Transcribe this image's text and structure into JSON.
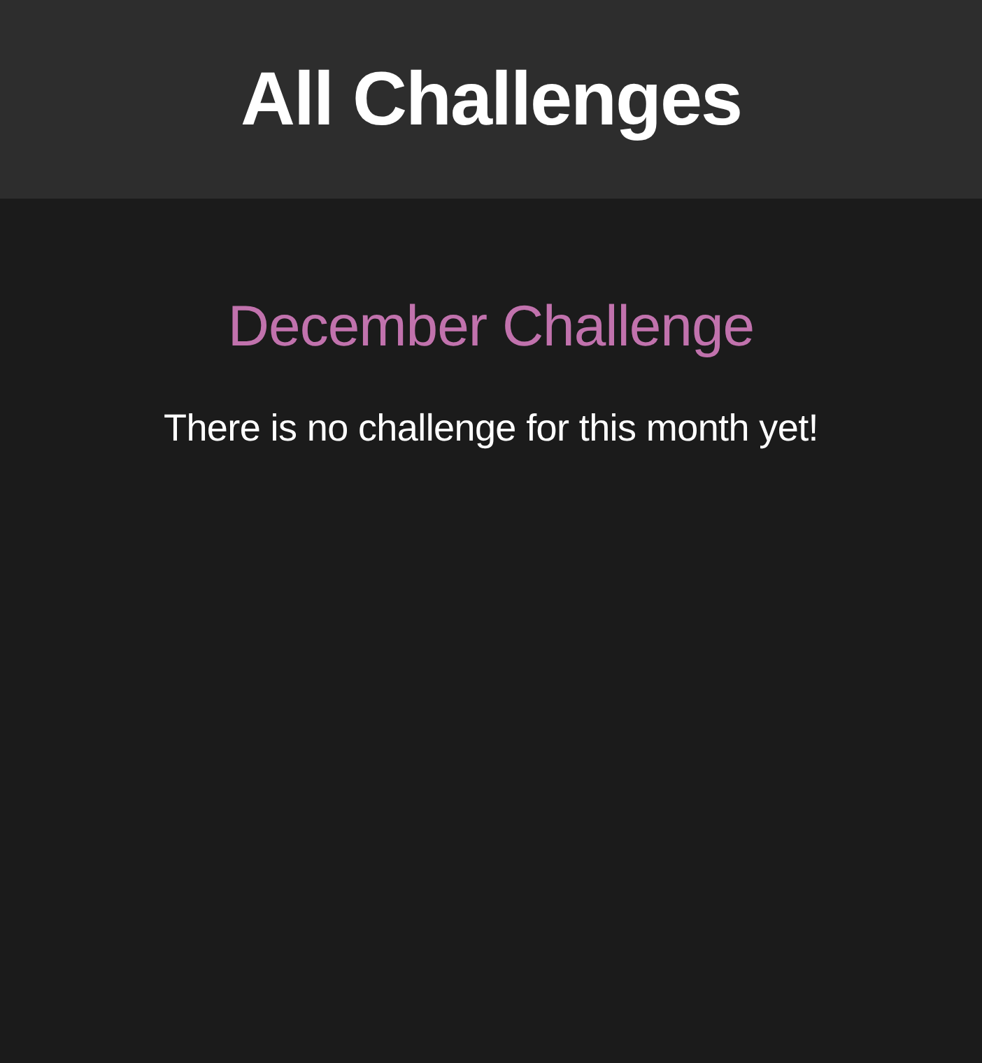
{
  "header": {
    "title": "All Challenges"
  },
  "challenge": {
    "title": "December Challenge",
    "message": "There is no challenge for this month yet!"
  }
}
